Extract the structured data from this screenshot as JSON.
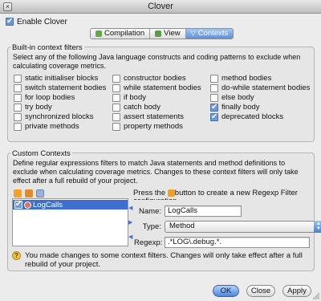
{
  "window": {
    "title": "Clover"
  },
  "enable_clover": {
    "label": "Enable Clover",
    "checked": true
  },
  "tabs": [
    {
      "label": "Compilation",
      "icon": "compilation-icon",
      "active": false
    },
    {
      "label": "View",
      "icon": "view-icon",
      "active": false
    },
    {
      "label": "Contexts",
      "icon": "contexts-filter-icon",
      "active": true
    }
  ],
  "builtin": {
    "title": "Built-in context filters",
    "description": "Select any of the following Java language constructs and coding patterns to exclude when calculating coverage metrics.",
    "columns": [
      [
        {
          "label": "static initialiser blocks",
          "checked": false
        },
        {
          "label": "switch statement bodies",
          "checked": false
        },
        {
          "label": "for loop bodies",
          "checked": false
        },
        {
          "label": "try body",
          "checked": false
        },
        {
          "label": "synchronized blocks",
          "checked": false
        },
        {
          "label": "private methods",
          "checked": false
        }
      ],
      [
        {
          "label": "constructor bodies",
          "checked": false
        },
        {
          "label": "while statement bodies",
          "checked": false
        },
        {
          "label": "if body",
          "checked": false
        },
        {
          "label": "catch body",
          "checked": false
        },
        {
          "label": "assert statements",
          "checked": false
        },
        {
          "label": "property methods",
          "checked": false
        }
      ],
      [
        {
          "label": "method bodies",
          "checked": false
        },
        {
          "label": "do-while statement bodies",
          "checked": false
        },
        {
          "label": "else body",
          "checked": false
        },
        {
          "label": "finally body",
          "checked": true
        },
        {
          "label": "deprecated blocks",
          "checked": true
        }
      ]
    ]
  },
  "custom": {
    "title": "Custom Contexts",
    "description": "Define regular expressions filters to match Java statements and method definitions to exclude when calculating coverage metrics. Changes to these context filters will only take effect after a full rebuild of your project.",
    "toolbar_icons": [
      "add-filter-icon",
      "remove-filter-icon",
      "copy-filter-icon"
    ],
    "list": [
      {
        "label": "LogCalls",
        "checked": true,
        "selected": true
      }
    ],
    "hint_before": "Press the",
    "hint_after": "button to create a new Regexp Filter configuration",
    "name_label": "Name:",
    "name_value": "LogCalls",
    "type_label": "Type:",
    "type_value": "Method",
    "regexp_label": "Regexp:",
    "regexp_value": ".*LOG\\.debug.*."
  },
  "warning": {
    "icon": "warning-icon",
    "text": "You made changes to some context filters. Changes will only take effect after a full rebuild of your project."
  },
  "buttons": {
    "ok": "OK",
    "close": "Close",
    "apply": "Apply"
  }
}
